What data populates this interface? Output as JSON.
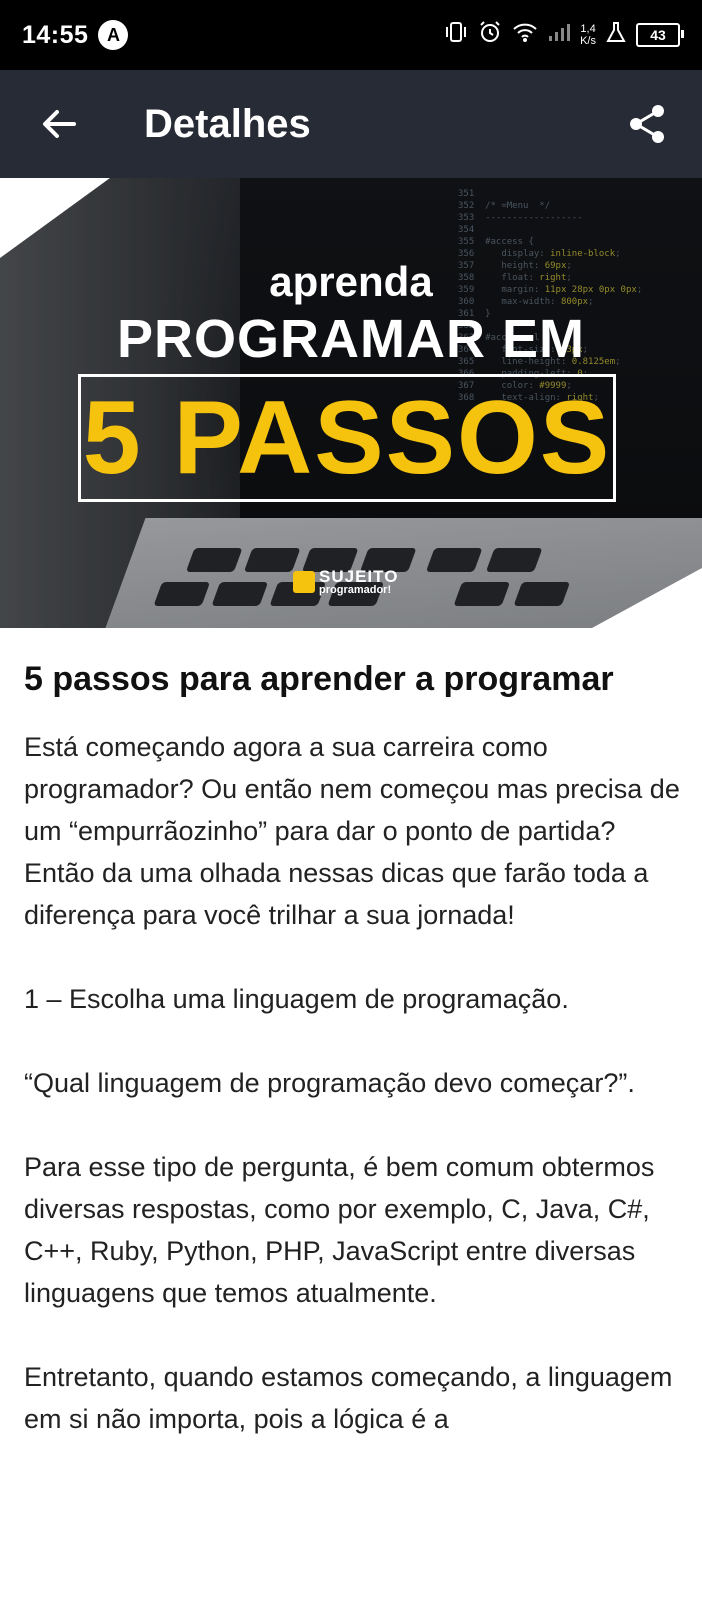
{
  "status_bar": {
    "time": "14:55",
    "badge": "A",
    "speed_value": "1,4",
    "speed_unit": "K/s",
    "battery": "43"
  },
  "app_bar": {
    "title": "Detalhes",
    "back_icon": "arrow-left-icon",
    "share_icon": "share-icon"
  },
  "hero": {
    "subtitle": "aprenda",
    "headline": "PROGRAMAR EM",
    "highlight": "5 PASSOS",
    "brand_name": "SUJEITO",
    "brand_sub": "programador!",
    "highlight_color": "#f5c20e"
  },
  "article": {
    "title": "5 passos para aprender a programar",
    "paragraphs": [
      "Está começando agora a sua carreira como programador? Ou então nem começou mas precisa de um “empurrãozinho” para dar o ponto de partida? Então da uma olhada nessas dicas que farão toda a diferença para você trilhar a sua jornada!",
      "1 – Escolha uma linguagem de programação.",
      "“Qual linguagem de programação devo começar?”.",
      "Para esse tipo de pergunta, é bem comum obtermos diversas respostas, como por exemplo, C, Java, C#, C++, Ruby, Python, PHP, JavaScript entre diversas linguagens que temos atualmente.",
      "Entretanto, quando estamos começando, a linguagem em si não importa, pois a lógica é a"
    ]
  }
}
